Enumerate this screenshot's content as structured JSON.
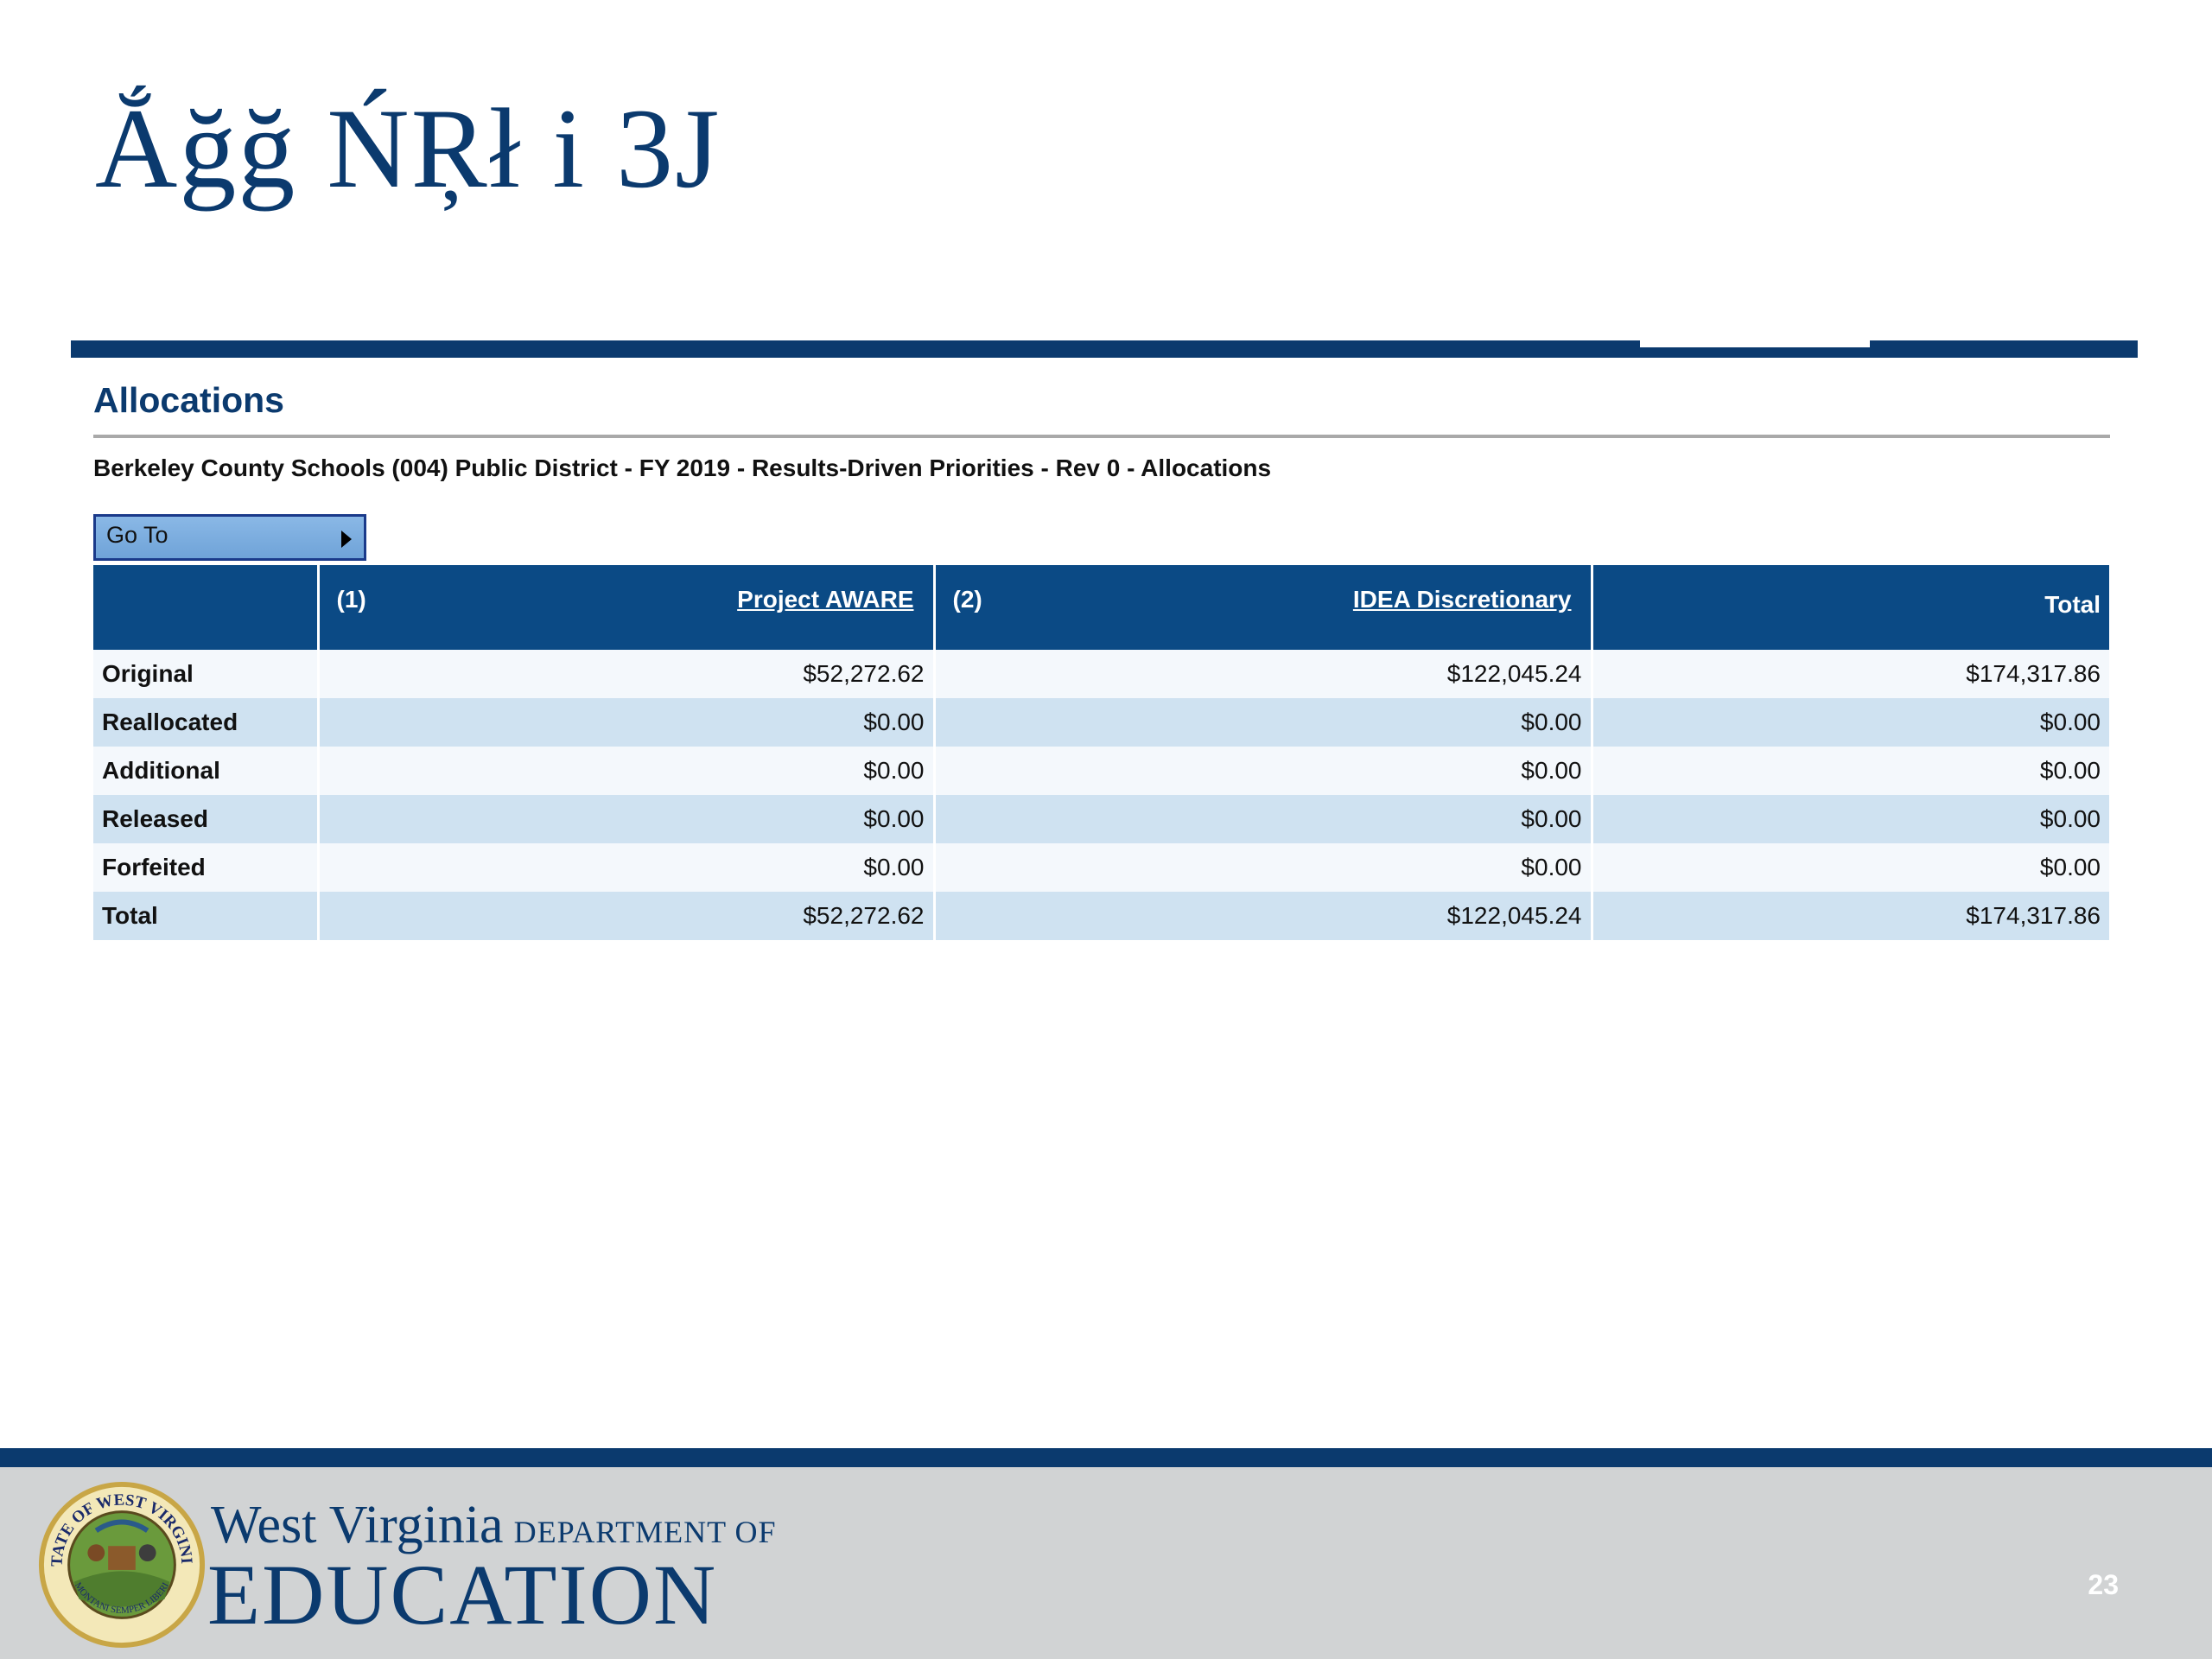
{
  "slide": {
    "title": "Ắğğ ŃŖł i 3J",
    "page_number": "23"
  },
  "panel": {
    "title": "Allocations",
    "breadcrumb": "Berkeley County Schools (004) Public District - FY 2019 - Results-Driven Priorities - Rev 0 - Allocations",
    "goto_label": "Go To"
  },
  "table": {
    "columns": [
      {
        "number": "(1)",
        "name": "Project AWARE"
      },
      {
        "number": "(2)",
        "name": "IDEA Discretionary"
      }
    ],
    "total_header": "Total",
    "rows": [
      {
        "label": "Original",
        "values": [
          "$52,272.62",
          "$122,045.24",
          "$174,317.86"
        ]
      },
      {
        "label": "Reallocated",
        "values": [
          "$0.00",
          "$0.00",
          "$0.00"
        ]
      },
      {
        "label": "Additional",
        "values": [
          "$0.00",
          "$0.00",
          "$0.00"
        ]
      },
      {
        "label": "Released",
        "values": [
          "$0.00",
          "$0.00",
          "$0.00"
        ]
      },
      {
        "label": "Forfeited",
        "values": [
          "$0.00",
          "$0.00",
          "$0.00"
        ]
      },
      {
        "label": "Total",
        "values": [
          "$52,272.62",
          "$122,045.24",
          "$174,317.86"
        ]
      }
    ]
  },
  "footer": {
    "org_line1": "West Virginia",
    "org_line1_small": "DEPARTMENT OF",
    "org_line2": "EDUCATION",
    "seal_text": "STATE OF WEST VIRGINIA",
    "seal_motto": "MONTANI SEMPER LIBERI"
  },
  "colors": {
    "brand_navy": "#0b3a6e",
    "table_header": "#0b4a85",
    "row_light": "#f4f8fc",
    "row_blue": "#cfe2f1",
    "footer_gray": "#d1d3d4",
    "goto_blue": "#7aaee0"
  },
  "icons": {
    "goto": "caret-right-icon",
    "seal": "state-seal-icon"
  }
}
